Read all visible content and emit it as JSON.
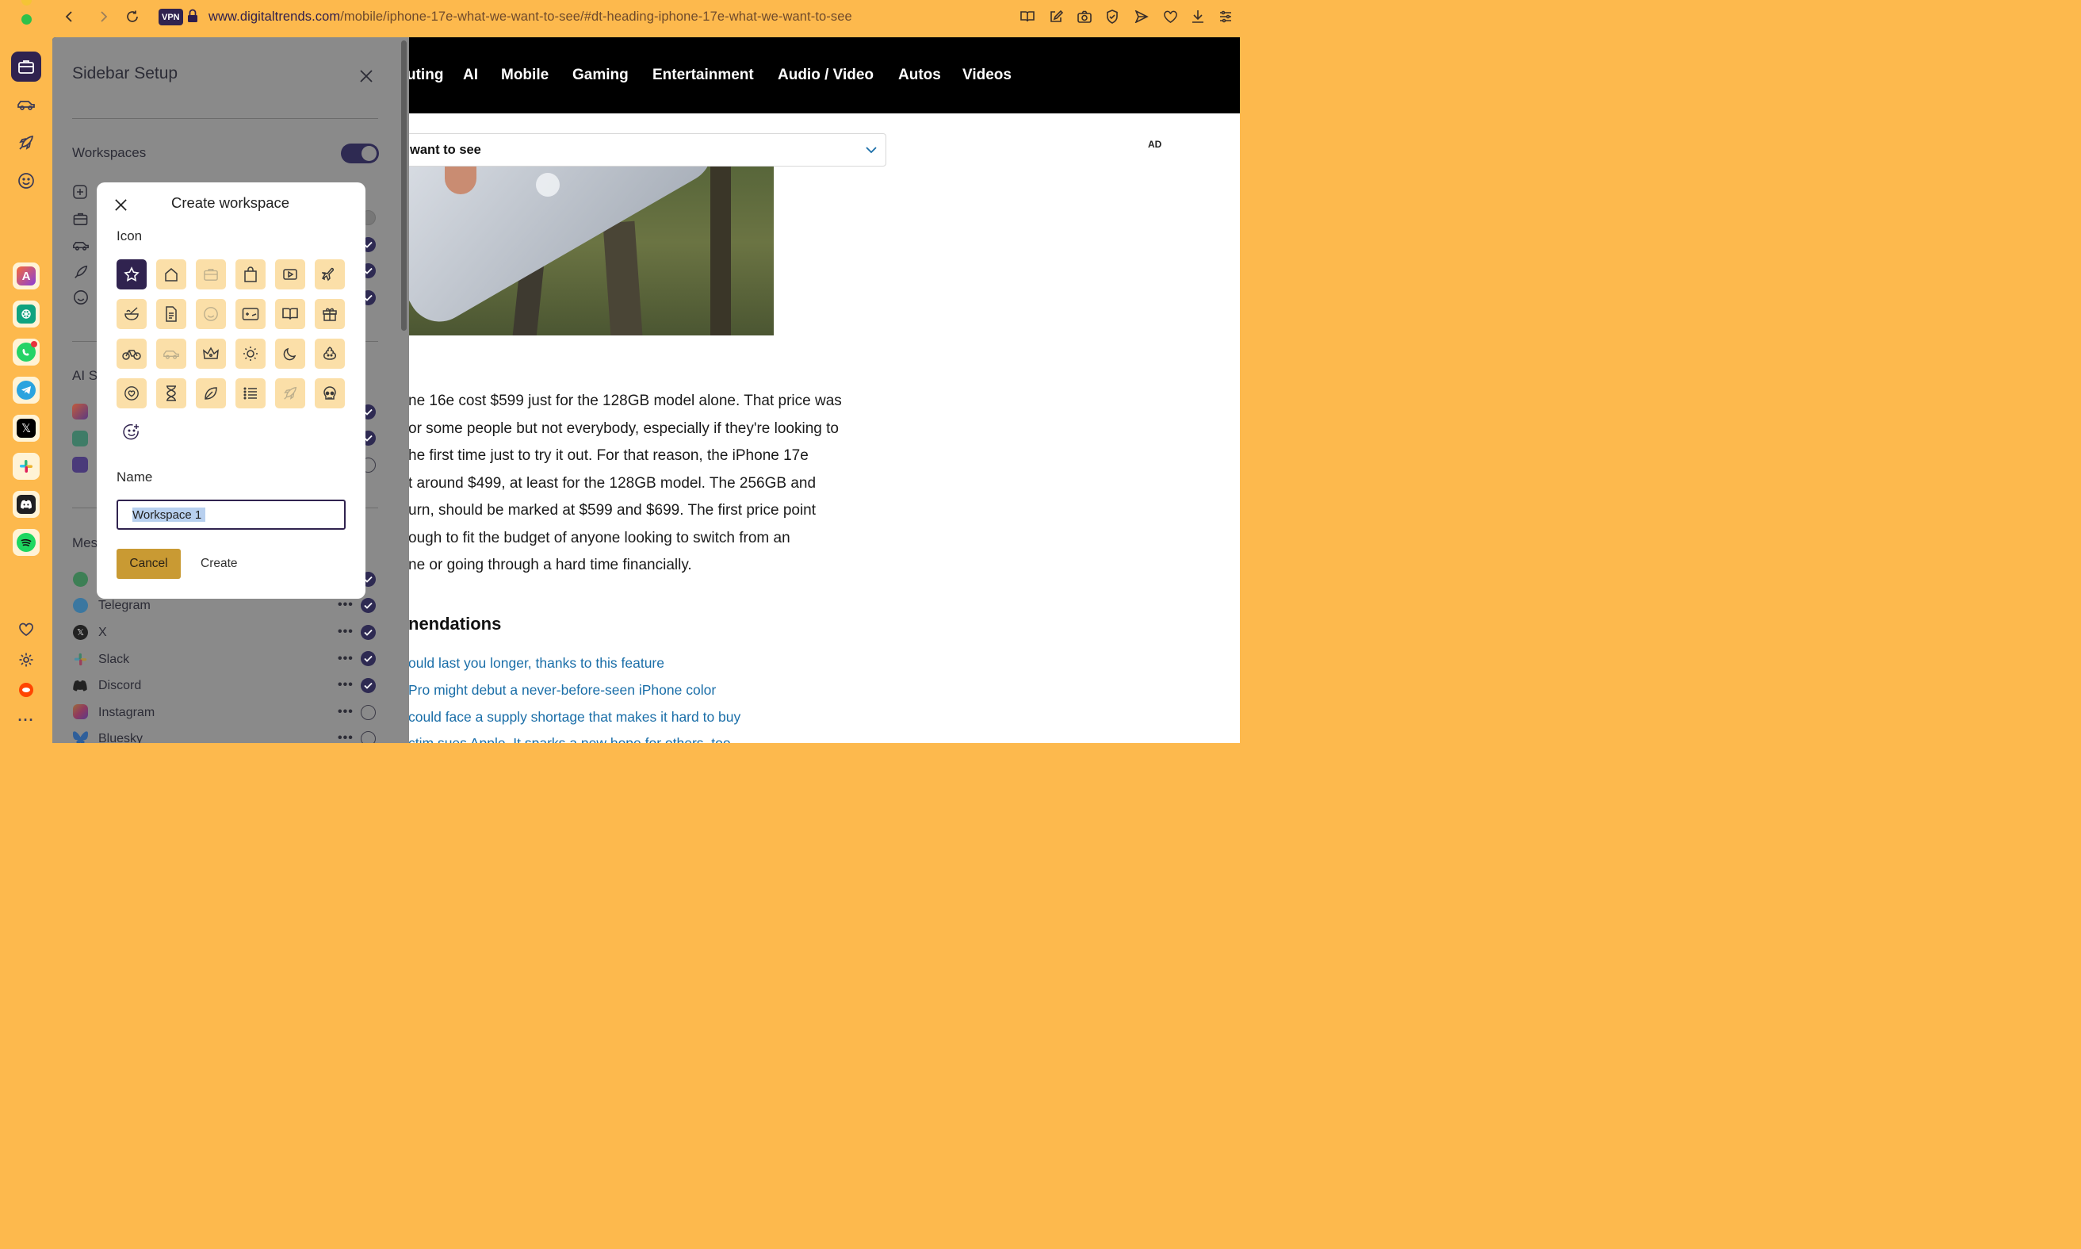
{
  "browser": {
    "vpn_label": "VPN",
    "url_host": "www.digitaltrends.com",
    "url_path": "/mobile/iphone-17e-what-we-want-to-see/#dt-heading-iphone-17e-what-we-want-to-see"
  },
  "site": {
    "nav": [
      "uting",
      "AI",
      "Mobile",
      "Gaming",
      "Entertainment",
      "Audio / Video",
      "Autos",
      "Videos"
    ],
    "toc_label": "want to see",
    "ad_label": "AD",
    "article_lines": [
      "ne 16e cost $599 just for the 128GB model alone. That price was",
      "or some people but not everybody, especially if they're looking to",
      "he first time just to try it out. For that reason, the iPhone 17e",
      "t around $499, at least for the 128GB model. The 256GB and",
      "urn, should be marked at $599 and $699. The first price point",
      "ough to fit the budget of anyone looking to switch from an",
      "ne or going through a hard time financially."
    ],
    "recommendations_heading": "nendations",
    "recommendations": [
      "ould last you longer, thanks to this feature",
      "Pro might debut a never-before-seen iPhone color",
      "could face a supply shortage that makes it hard to buy",
      "ctim sues Apple. It sparks a new hope for others, too"
    ]
  },
  "sidebar_setup": {
    "title": "Sidebar Setup",
    "workspaces_label": "Workspaces",
    "ai_label": "AI S",
    "messengers_label": "Mes",
    "messengers": [
      {
        "name": "Telegram",
        "checked": true
      },
      {
        "name": "X",
        "checked": true
      },
      {
        "name": "Slack",
        "checked": true
      },
      {
        "name": "Discord",
        "checked": true
      },
      {
        "name": "Instagram",
        "checked": false
      },
      {
        "name": "Bluesky",
        "checked": false
      }
    ],
    "dots": "•••"
  },
  "modal": {
    "title": "Create workspace",
    "icon_label": "Icon",
    "name_label": "Name",
    "name_value": "Workspace 1",
    "cancel_label": "Cancel",
    "create_label": "Create",
    "icons": [
      [
        "star-icon",
        "home-icon",
        "briefcase-icon",
        "shopping-bag-icon",
        "video-icon",
        "airplane-icon"
      ],
      [
        "bowl-icon",
        "document-icon",
        "smiley-icon",
        "gamepad-icon",
        "book-icon",
        "gift-icon"
      ],
      [
        "bicycle-icon",
        "car-icon",
        "crown-icon",
        "sun-icon",
        "moon-icon",
        "poop-icon"
      ],
      [
        "heart-face-icon",
        "hourglass-icon",
        "leaf-icon",
        "list-icon",
        "rocket-icon",
        "skull-icon"
      ]
    ],
    "selected_icon": "star-icon"
  }
}
